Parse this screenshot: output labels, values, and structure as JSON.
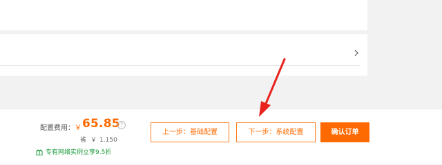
{
  "config_panel": {
    "chevron": ">"
  },
  "order_bar": {
    "fee_label": "配置费用：",
    "currency": "￥",
    "fee_amount": "65.85",
    "help_glyph": "?",
    "save_label": "省",
    "save_currency": "￥",
    "save_amount": "1.150",
    "promo_text": "专有网络实例立享9.5折",
    "prev_button": "上一步：基础配置",
    "next_button": "下一步：系统配置",
    "confirm_button": "确认订单"
  },
  "colors": {
    "accent": "#ff6a00",
    "promo_green": "#1d9a3e",
    "annotation_red": "#e8231d"
  },
  "icons": {
    "help": "question-circle-icon",
    "promo": "gift-icon",
    "chevron": "chevron-right-icon",
    "annotation": "red-arrow-icon"
  }
}
